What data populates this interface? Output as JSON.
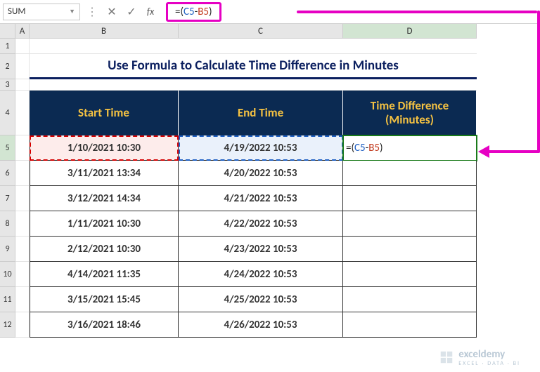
{
  "nameBox": "SUM",
  "formulaBar": {
    "fx": "fx",
    "raw": "=(C5-B5)",
    "eq": "=(",
    "ref1": "C5",
    "dash": "-",
    "ref2": "B5",
    "close": ")"
  },
  "columns": {
    "A": "A",
    "B": "B",
    "C": "C",
    "D": "D"
  },
  "rows": [
    "1",
    "2",
    "3",
    "4",
    "5",
    "6",
    "7",
    "8",
    "9",
    "10",
    "11",
    "12"
  ],
  "title": "Use Formula to Calculate Time Difference in Minutes",
  "headers": {
    "start": "Start Time",
    "end": "End Time",
    "diff1": "Time Difference",
    "diff2": "(Minutes)"
  },
  "cellEdit": {
    "eq": "=(",
    "ref1": "C5",
    "dash": "-",
    "ref2": "B5",
    "close": ")"
  },
  "data": [
    {
      "start": "1/10/2021 10:30",
      "end": "4/19/2022 10:53"
    },
    {
      "start": "3/11/2021 13:34",
      "end": "4/20/2022 10:53"
    },
    {
      "start": "3/12/2021 14:34",
      "end": "4/21/2022 10:53"
    },
    {
      "start": "1/11/2021 10:30",
      "end": "4/22/2022 10:53"
    },
    {
      "start": "2/12/2021 10:30",
      "end": "4/23/2022 10:53"
    },
    {
      "start": "4/14/2021 11:35",
      "end": "4/24/2022 10:53"
    },
    {
      "start": "3/15/2021 15:45",
      "end": "4/25/2022 10:53"
    },
    {
      "start": "3/16/2021 18:46",
      "end": "4/26/2022 10:53"
    }
  ],
  "watermark": {
    "brand": "exceldemy",
    "sub": "EXCEL · DATA · BI"
  }
}
